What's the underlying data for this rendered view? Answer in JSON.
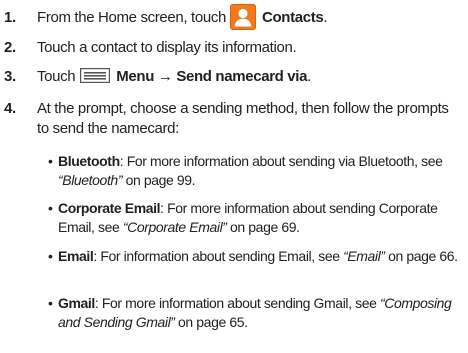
{
  "steps": [
    {
      "number": "1.",
      "before": "From the Home screen, touch",
      "icon": "contacts-icon",
      "target": "Contacts",
      "after": "."
    },
    {
      "number": "2.",
      "text": "Touch a contact to display its information."
    },
    {
      "number": "3.",
      "before": "Touch",
      "icon": "menu-icon",
      "target": "Menu → Send namecard via",
      "after": "."
    },
    {
      "number": "4.",
      "text": "At the prompt, choose a sending method, then follow the prompts to send the namecard:"
    }
  ],
  "methods": [
    {
      "name": "Bluetooth",
      "before": ": For more information about sending via Bluetooth, see ",
      "ref": "“Bluetooth”",
      "after": " on page 99."
    },
    {
      "name": "Corporate Email",
      "before": ": For more information about sending Corporate Email, see ",
      "ref": "“Corporate Email”",
      "after": " on page 69."
    },
    {
      "name": "Email",
      "before": ": For information about sending Email, see ",
      "ref": "“Email”",
      "after": " on page 66."
    },
    {
      "name": "Gmail",
      "before": ": For more information about sending Gmail, see ",
      "ref": "“Composing and Sending Gmail”",
      "after": " on page 65."
    }
  ],
  "colors": {
    "text": "#222222",
    "contacts_icon_bg": "#f07a1c",
    "menu_icon": "#555555"
  }
}
